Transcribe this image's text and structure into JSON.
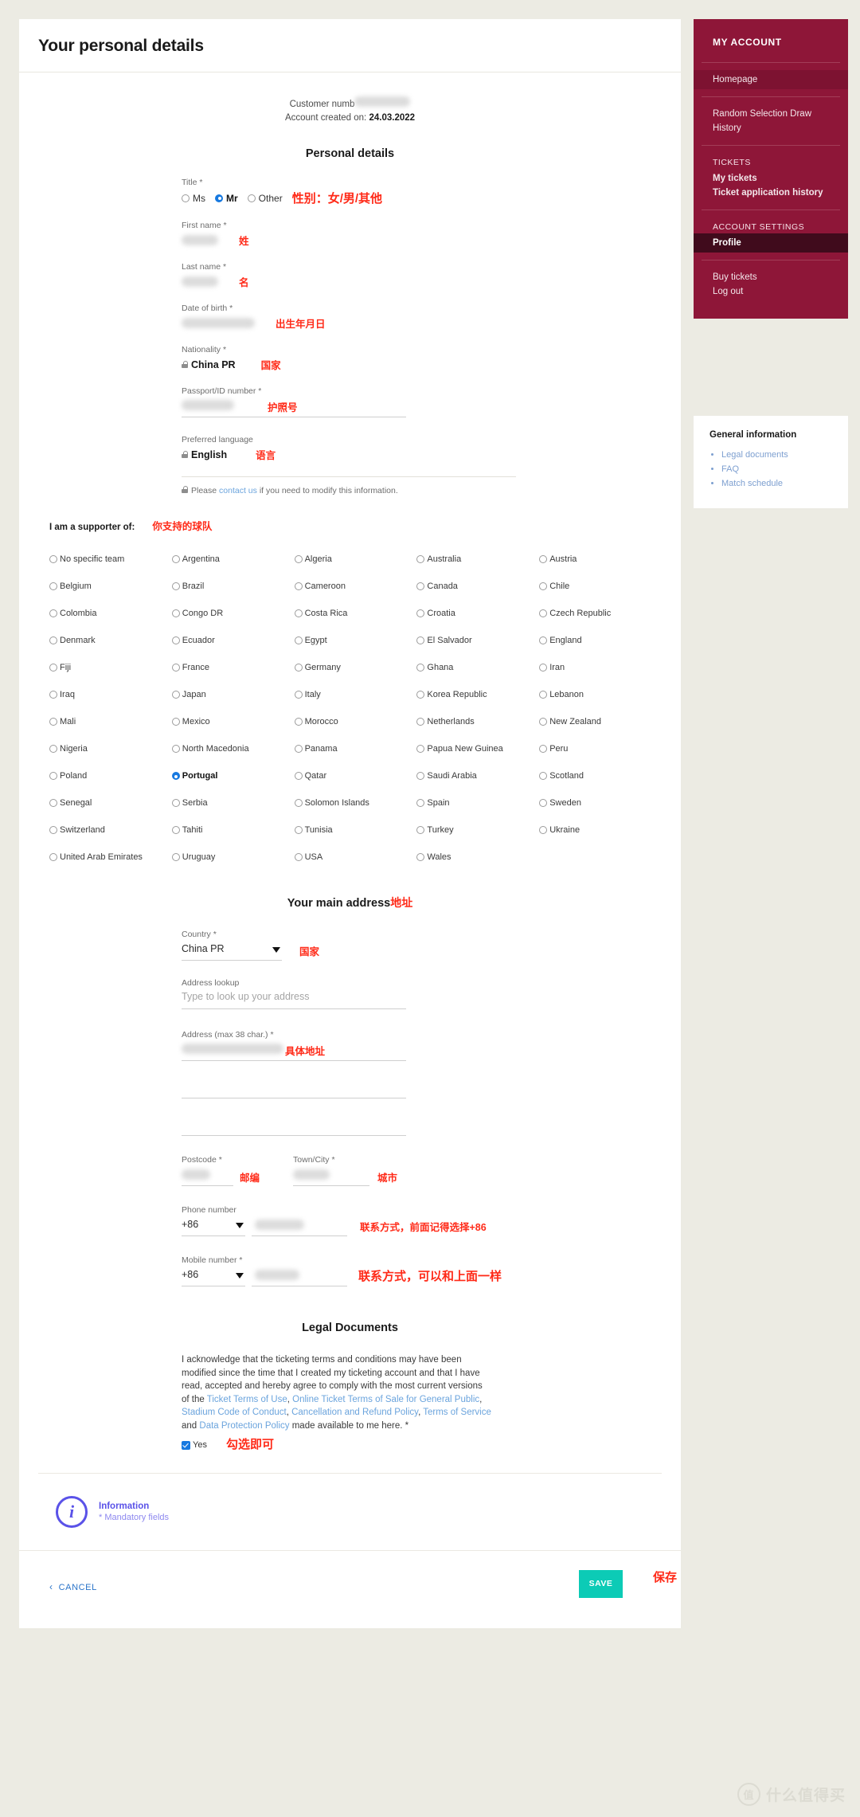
{
  "header": {
    "page_title": "Your personal details"
  },
  "account": {
    "customer_number_label": "Customer numb",
    "created_label": "Account created on:",
    "created_date": "24.03.2022"
  },
  "personal": {
    "section_title": "Personal details",
    "title_label": "Title",
    "title_options": [
      "Ms",
      "Mr",
      "Other"
    ],
    "title_selected": "Mr",
    "title_note_cn": "性别：女/男/其他",
    "first_name_label": "First name",
    "first_name_note_cn": "姓",
    "last_name_label": "Last name",
    "last_name_note_cn": "名",
    "dob_label": "Date of birth",
    "dob_note_cn": "出生年月日",
    "nationality_label": "Nationality",
    "nationality_value": "China PR",
    "nationality_note_cn": "国家",
    "passport_label": "Passport/ID number",
    "passport_note_cn": "护照号",
    "language_label": "Preferred language",
    "language_value": "English",
    "language_note_cn": "语言",
    "contact_note_pre": "Please ",
    "contact_note_link": "contact us",
    "contact_note_post": " if you need to modify this information.",
    "required_mark": "*"
  },
  "supporter": {
    "label": "I am a supporter of:",
    "note_cn": "你支持的球队",
    "selected": "Portugal",
    "teams": [
      "No specific team",
      "Argentina",
      "Algeria",
      "Australia",
      "Austria",
      "Belgium",
      "Brazil",
      "Cameroon",
      "Canada",
      "Chile",
      "Colombia",
      "Congo DR",
      "Costa Rica",
      "Croatia",
      "Czech Republic",
      "Denmark",
      "Ecuador",
      "Egypt",
      "El Salvador",
      "England",
      "Fiji",
      "France",
      "Germany",
      "Ghana",
      "Iran",
      "Iraq",
      "Japan",
      "Italy",
      "Korea Republic",
      "Lebanon",
      "Mali",
      "Mexico",
      "Morocco",
      "Netherlands",
      "New Zealand",
      "Nigeria",
      "North Macedonia",
      "Panama",
      "Papua New Guinea",
      "Peru",
      "Poland",
      "Portugal",
      "Qatar",
      "Saudi Arabia",
      "Scotland",
      "Senegal",
      "Serbia",
      "Solomon Islands",
      "Spain",
      "Sweden",
      "Switzerland",
      "Tahiti",
      "Tunisia",
      "Turkey",
      "Ukraine",
      "United Arab Emirates",
      "Uruguay",
      "USA",
      "Wales"
    ]
  },
  "address": {
    "section_title": "Your main address",
    "section_note_cn": "地址",
    "country_label": "Country",
    "country_value": "China PR",
    "country_note_cn": "国家",
    "lookup_label": "Address lookup",
    "lookup_placeholder": "Type to look up your address",
    "address_label": "Address  (max 38 char.)",
    "address_note_cn": "具体地址",
    "postcode_label": "Postcode",
    "postcode_note_cn": "邮编",
    "city_label": "Town/City",
    "city_note_cn": "城市",
    "phone_label": "Phone number",
    "phone_prefix": "+86",
    "phone_note_cn": "联系方式，前面记得选择+86",
    "mobile_label": "Mobile number",
    "mobile_prefix": "+86",
    "mobile_note_cn": "联系方式，可以和上面一样"
  },
  "legal": {
    "section_title": "Legal Documents",
    "body_1": "I acknowledge that the ticketing terms and conditions may have been modified since the time that I created my ticketing account and that I have read, accepted and hereby agree to comply with the most current versions of the ",
    "link_1": "Ticket Terms of Use",
    "sep_1": ", ",
    "link_2": "Online Ticket Terms of Sale for General Public",
    "sep_2": ", ",
    "link_3": "Stadium Code of Conduct",
    "sep_3": ", ",
    "link_4": "Cancellation and Refund Policy",
    "sep_4": ", ",
    "link_5": "Terms of Service",
    "sep_5": " and ",
    "link_6": "Data Protection Policy",
    "body_2": " made available to me here.  *",
    "checkbox_label": "Yes",
    "checkbox_note_cn": "勾选即可"
  },
  "info": {
    "title": "Information",
    "subtitle": "* Mandatory fields",
    "icon_glyph": "i"
  },
  "actions": {
    "cancel_label": "CANCEL",
    "cancel_chevron": "‹",
    "save_label": "SAVE",
    "save_note_cn": "保存"
  },
  "sidebar": {
    "heading": "MY ACCOUNT",
    "homepage": "Homepage",
    "draw_line1": "Random Selection Draw",
    "draw_line2": "History",
    "tickets_cat": "TICKETS",
    "my_tickets": "My tickets",
    "ticket_history": "Ticket application history",
    "settings_cat": "ACCOUNT SETTINGS",
    "profile": "Profile",
    "buy_tickets": "Buy tickets",
    "log_out": "Log out"
  },
  "general_info": {
    "title": "General information",
    "items": [
      "Legal documents",
      "FAQ",
      "Match schedule"
    ]
  },
  "watermark": {
    "mark": "值",
    "text": "什么值得买"
  },
  "colors": {
    "sidebar": "#8e1638",
    "sidebar_active": "#400b1c",
    "save": "#0ccbb6",
    "accent_link": "#6ba4dd",
    "note_red": "#ff2a18",
    "info_purple": "#5a52e8",
    "page_bg": "#ecebe3"
  }
}
